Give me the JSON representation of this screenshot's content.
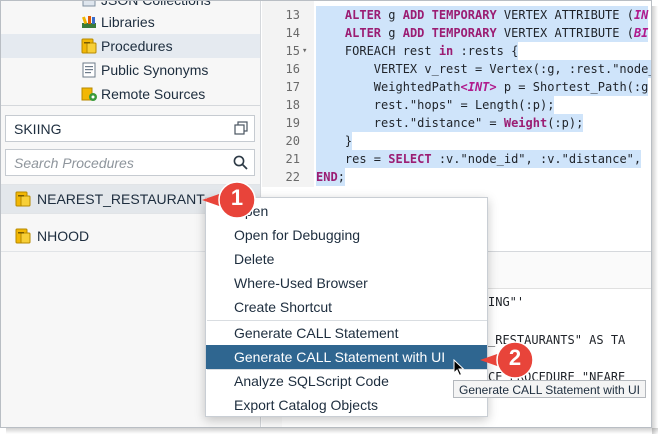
{
  "tree": {
    "items": [
      {
        "label": "JSON Collections",
        "icon": "json-collections-icon"
      },
      {
        "label": "Libraries",
        "icon": "libraries-icon"
      },
      {
        "label": "Procedures",
        "icon": "procedures-icon"
      },
      {
        "label": "Public Synonyms",
        "icon": "public-synonyms-icon"
      },
      {
        "label": "Remote Sources",
        "icon": "remote-sources-icon"
      }
    ]
  },
  "schema": {
    "value": "SKIING"
  },
  "search": {
    "placeholder": "Search Procedures"
  },
  "procedures": [
    {
      "name": "NEAREST_RESTAURANT"
    },
    {
      "name": "NHOOD"
    }
  ],
  "editor": {
    "lines": [
      {
        "num": "13",
        "parts": [
          {
            "t": "    "
          },
          {
            "t": "ALTER",
            "c": "kw"
          },
          {
            "t": " g "
          },
          {
            "t": "ADD",
            "c": "kw"
          },
          {
            "t": " "
          },
          {
            "t": "TEMPORARY",
            "c": "kw"
          },
          {
            "t": " VERTEX ATTRIBUTE ("
          },
          {
            "t": "IN",
            "c": "ty"
          }
        ]
      },
      {
        "num": "14",
        "parts": [
          {
            "t": "    "
          },
          {
            "t": "ALTER",
            "c": "kw"
          },
          {
            "t": " g "
          },
          {
            "t": "ADD",
            "c": "kw"
          },
          {
            "t": " "
          },
          {
            "t": "TEMPORARY",
            "c": "kw"
          },
          {
            "t": " VERTEX ATTRIBUTE ("
          },
          {
            "t": "BI",
            "c": "ty"
          }
        ]
      },
      {
        "num": "15",
        "fold": "▾",
        "parts": [
          {
            "t": "    FOREACH rest "
          },
          {
            "t": "in",
            "c": "kw"
          },
          {
            "t": " :rests {"
          }
        ]
      },
      {
        "num": "16",
        "parts": [
          {
            "t": "        VERTEX v_rest = Vertex(:g, :rest.\"node_"
          }
        ]
      },
      {
        "num": "17",
        "parts": [
          {
            "t": "        WeightedPath"
          },
          {
            "t": "<INT>",
            "c": "ty"
          },
          {
            "t": " p = Shortest_Path(:g"
          }
        ]
      },
      {
        "num": "18",
        "parts": [
          {
            "t": "        rest.\"hops\" = Length(:p);"
          }
        ]
      },
      {
        "num": "19",
        "parts": [
          {
            "t": "        rest.\"distance\" = "
          },
          {
            "t": "Weight",
            "c": "kw"
          },
          {
            "t": "(:p);"
          }
        ]
      },
      {
        "num": "20",
        "parts": [
          {
            "t": "    }"
          }
        ]
      },
      {
        "num": "21",
        "parts": [
          {
            "t": "    res = "
          },
          {
            "t": "SELECT",
            "c": "kw"
          },
          {
            "t": " :v.\"node_id\", :v.\"distance\","
          }
        ]
      },
      {
        "num": "22",
        "parts": [
          {
            "t": "END",
            "c": "kw"
          },
          {
            "t": ";"
          }
        ]
      }
    ],
    "fragments": [
      {
        "text": "ING\"'"
      },
      {
        "text": "_RESTAURANTS\" AS TA"
      },
      {
        "text": "CE PROCEDURE \"NEARE"
      }
    ]
  },
  "context_menu": {
    "items": [
      {
        "label": "Open",
        "name": "menu-open"
      },
      {
        "label": "Open for Debugging",
        "name": "menu-open-for-debugging"
      },
      {
        "label": "Delete",
        "name": "menu-delete"
      },
      {
        "label": "Where-Used Browser",
        "name": "menu-where-used-browser"
      },
      {
        "label": "Create Shortcut",
        "name": "menu-create-shortcut"
      },
      {
        "label": "Generate CALL Statement",
        "name": "menu-generate-call-statement"
      },
      {
        "label": "Generate CALL Statement with UI",
        "name": "menu-generate-call-statement-with-ui",
        "active": true
      },
      {
        "label": "Analyze SQLScript Code",
        "name": "menu-analyze-sqlscript-code"
      },
      {
        "label": "Export Catalog Objects",
        "name": "menu-export-catalog-objects"
      }
    ]
  },
  "callouts": [
    {
      "number": "1"
    },
    {
      "number": "2"
    }
  ],
  "tooltip": {
    "text": "Generate CALL Statement with UI"
  },
  "colors": {
    "callout": "#e8443a",
    "menu_active": "#2f6690",
    "code_highlight": "#cfe4fa",
    "keyword": "#9b1d73"
  }
}
